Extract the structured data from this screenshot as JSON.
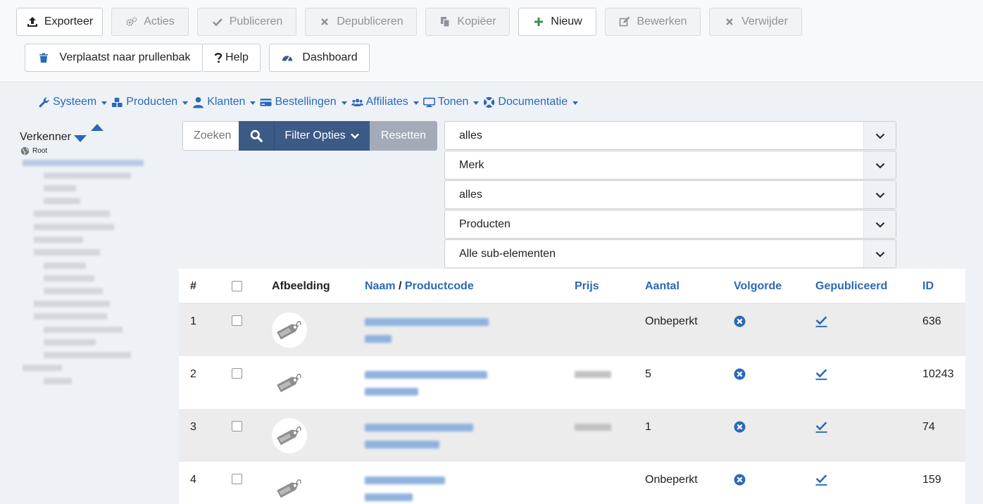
{
  "toolbar": {
    "buttons": [
      {
        "label": "Exporteer",
        "icon": "upload-icon",
        "disabled": false
      },
      {
        "label": "Acties",
        "icon": "gears-icon",
        "disabled": true
      },
      {
        "label": "Publiceren",
        "icon": "check-icon",
        "disabled": true
      },
      {
        "label": "Depubliceren",
        "icon": "times-icon",
        "disabled": true
      },
      {
        "label": "Kopiëer",
        "icon": "copy-icon",
        "disabled": true
      },
      {
        "label": "Nieuw",
        "icon": "plus-icon",
        "disabled": false
      },
      {
        "label": "Bewerken",
        "icon": "edit-icon",
        "disabled": true
      },
      {
        "label": "Verwijder",
        "icon": "times-icon",
        "disabled": true
      },
      {
        "label": "Verplaatst naar prullenbak",
        "icon": "trash-icon",
        "disabled": false
      },
      {
        "label": "Help",
        "icon": "question-icon",
        "disabled": false
      },
      {
        "label": "Dashboard",
        "icon": "dashboard-icon",
        "disabled": false
      }
    ]
  },
  "menu": {
    "items": [
      {
        "label": "Systeem",
        "icon": "wrench-icon"
      },
      {
        "label": "Producten",
        "icon": "cubes-icon"
      },
      {
        "label": "Klanten",
        "icon": "user-icon"
      },
      {
        "label": "Bestellingen",
        "icon": "credit-card-icon"
      },
      {
        "label": "Affiliates",
        "icon": "users-icon"
      },
      {
        "label": "Tonen",
        "icon": "monitor-icon"
      },
      {
        "label": "Documentatie",
        "icon": "lifebuoy-icon"
      }
    ]
  },
  "explorer": {
    "title": "Verkenner",
    "root": "Root"
  },
  "search": {
    "placeholder": "Zoeken",
    "filter_label": "Filter Opties",
    "reset_label": "Resetten"
  },
  "filters": [
    "alles",
    "Merk",
    "alles",
    "Producten",
    "Alle sub-elementen"
  ],
  "table": {
    "headers": {
      "num": "#",
      "image": "Afbeelding",
      "name": "Naam",
      "separator": " / ",
      "code": "Productcode",
      "price": "Prijs",
      "qty": "Aantal",
      "order": "Volgorde",
      "published": "Gepubliceerd",
      "id": "ID"
    },
    "rows": [
      {
        "num": "1",
        "qty": "Onbeperkt",
        "id": "636"
      },
      {
        "num": "2",
        "qty": "5",
        "id": "10243"
      },
      {
        "num": "3",
        "qty": "1",
        "id": "74"
      },
      {
        "num": "4",
        "qty": "Onbeperkt",
        "id": "159"
      }
    ]
  },
  "colors": {
    "link": "#2a69b8",
    "primary_button": "#3c5a86",
    "reset_button": "#a2abb7"
  }
}
